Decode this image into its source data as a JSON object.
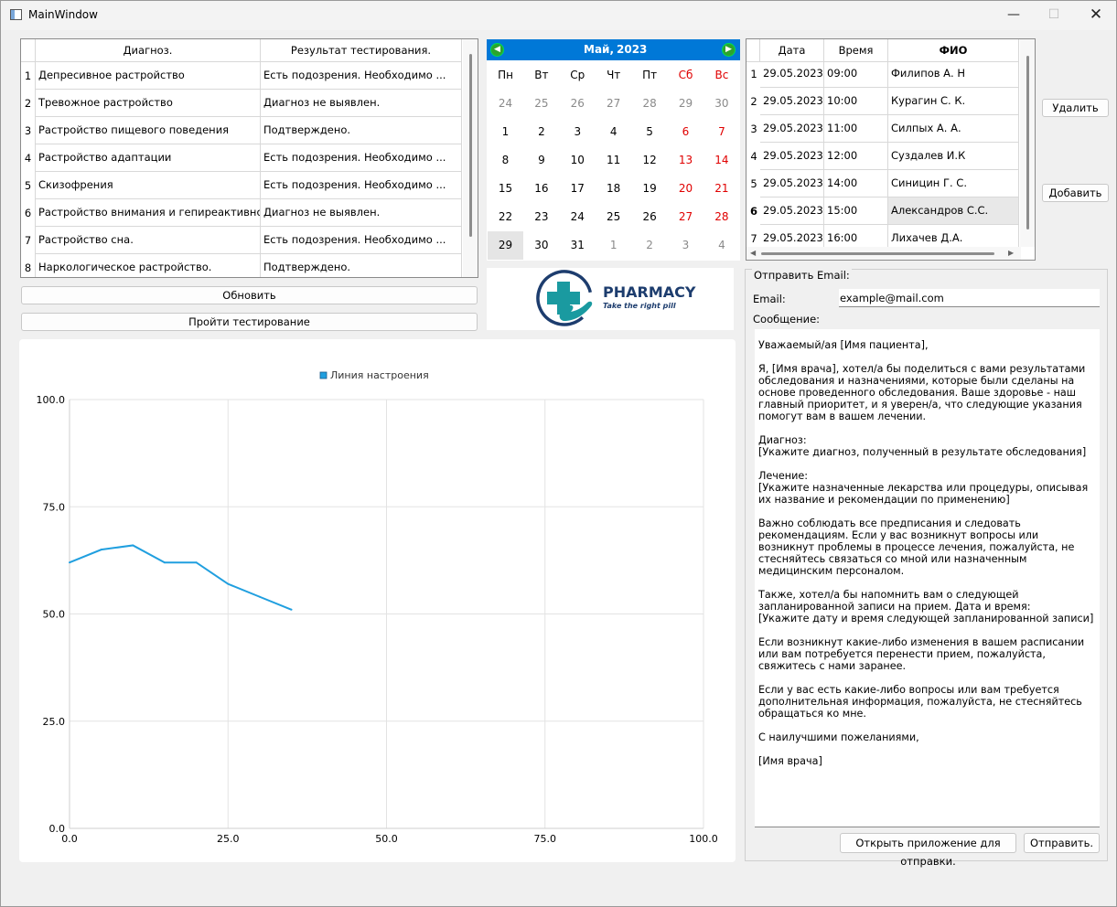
{
  "window": {
    "title": "MainWindow",
    "minimize": "—",
    "maximize": "☐",
    "close": "✕"
  },
  "diagnosis_table": {
    "headers": [
      "Диагноз.",
      "Результат тестирования."
    ],
    "rows": [
      {
        "n": "1",
        "diagnosis": "Депресивное растройство",
        "result": "Есть подозрения. Необходимо ..."
      },
      {
        "n": "2",
        "diagnosis": "Тревожное растройство",
        "result": "Диагноз не выявлен."
      },
      {
        "n": "3",
        "diagnosis": "Растройство пищевого поведения",
        "result": "Подтверждено."
      },
      {
        "n": "4",
        "diagnosis": "Растройство адаптации",
        "result": "Есть подозрения. Необходимо ..."
      },
      {
        "n": "5",
        "diagnosis": "Скизофрения",
        "result": "Есть подозрения. Необходимо ..."
      },
      {
        "n": "6",
        "diagnosis": "Растройство внимания и гепиреактивности",
        "result": "Диагноз не выявлен."
      },
      {
        "n": "7",
        "diagnosis": "Растройство сна.",
        "result": "Есть подозрения. Необходимо ..."
      },
      {
        "n": "8",
        "diagnosis": "Наркологическое растройство.",
        "result": "Подтверждено."
      }
    ]
  },
  "buttons": {
    "refresh": "Обновить",
    "take_test": "Пройти тестирование",
    "delete": "Удалить",
    "add": "Добавить",
    "open_app": "Открыть приложение для отправки.",
    "send": "Отправить."
  },
  "calendar": {
    "month": "Май,",
    "year": "2023",
    "prev_icon": "arrow-left-icon",
    "next_icon": "arrow-right-icon",
    "weekdays": [
      "Пн",
      "Вт",
      "Ср",
      "Чт",
      "Пт",
      "Сб",
      "Вс"
    ],
    "weeks": [
      [
        "24",
        "25",
        "26",
        "27",
        "28",
        "29",
        "30"
      ],
      [
        "1",
        "2",
        "3",
        "4",
        "5",
        "6",
        "7"
      ],
      [
        "8",
        "9",
        "10",
        "11",
        "12",
        "13",
        "14"
      ],
      [
        "15",
        "16",
        "17",
        "18",
        "19",
        "20",
        "21"
      ],
      [
        "22",
        "23",
        "24",
        "25",
        "26",
        "27",
        "28"
      ],
      [
        "29",
        "30",
        "31",
        "1",
        "2",
        "3",
        "4"
      ]
    ],
    "selected_day": "29",
    "colors": {
      "header": "#0078d7",
      "weekend": "#e00000",
      "other_month": "#8a8a8a",
      "selected_bg": "#e5e5e5"
    }
  },
  "logo": {
    "title": "PHARMACY",
    "tagline": "Take the right pill",
    "colors": {
      "teal": "#1a9aa0",
      "navy": "#1d3d6e"
    }
  },
  "appointments": {
    "headers": [
      "Дата",
      "Время",
      "ФИО"
    ],
    "rows": [
      {
        "n": "1",
        "date": "29.05.2023",
        "time": "09:00",
        "name": "Филипов А. Н"
      },
      {
        "n": "2",
        "date": "29.05.2023",
        "time": "10:00",
        "name": "Курагин С. К."
      },
      {
        "n": "3",
        "date": "29.05.2023",
        "time": "11:00",
        "name": "Силпых А. А."
      },
      {
        "n": "4",
        "date": "29.05.2023",
        "time": "12:00",
        "name": "Суздалев И.К"
      },
      {
        "n": "5",
        "date": "29.05.2023",
        "time": "14:00",
        "name": "Синицин Г. С."
      },
      {
        "n": "6",
        "date": "29.05.2023",
        "time": "15:00",
        "name": "Александров С.С."
      },
      {
        "n": "7",
        "date": "29.05.2023",
        "time": "16:00",
        "name": "Лихачев Д.А."
      }
    ],
    "selected_row": 5
  },
  "chart_data": {
    "type": "line",
    "legend": "Линия настроения",
    "legend_position": "top-center",
    "series": [
      {
        "name": "Линия настроения",
        "color": "#209fdf",
        "x": [
          0,
          5,
          10,
          15,
          20,
          25,
          30,
          35
        ],
        "y": [
          62,
          65,
          66,
          62,
          62,
          57,
          54,
          51
        ]
      }
    ],
    "xlim": [
      0,
      100
    ],
    "ylim": [
      0,
      100
    ],
    "x_ticks": [
      "0.0",
      "25.0",
      "50.0",
      "75.0",
      "100.0"
    ],
    "y_ticks": [
      "0.0",
      "25.0",
      "50.0",
      "75.0",
      "100.0"
    ],
    "grid": true
  },
  "email": {
    "group_title": "Отправить Email:",
    "email_label": "Email:",
    "email_value": "example@mail.com",
    "message_label": "Сообщение:",
    "message": "Уважаемый/ая [Имя пациента],\n\nЯ, [Имя врача], хотел/а бы поделиться с вами результатами обследования и назначениями, которые были сделаны на основе проведенного обследования. Ваше здоровье - наш главный приоритет, и я уверен/а, что следующие указания помогут вам в вашем лечении.\n\nДиагноз:\n[Укажите диагноз, полученный в результате обследования]\n\nЛечение:\n[Укажите назначенные лекарства или процедуры, описывая их название и рекомендации по применению]\n\nВажно соблюдать все предписания и следовать рекомендациям. Если у вас возникнут вопросы или возникнут проблемы в процессе лечения, пожалуйста, не стесняйтесь связаться со мной или назначенным медицинским персоналом.\n\nТакже, хотел/а бы напомнить вам о следующей запланированной записи на прием. Дата и время:\n[Укажите дату и время следующей запланированной записи]\n\nЕсли возникнут какие-либо изменения в вашем расписании или вам потребуется перенести прием, пожалуйста, свяжитесь с нами заранее.\n\nЕсли у вас есть какие-либо вопросы или вам требуется дополнительная информация, пожалуйста, не стесняйтесь обращаться ко мне.\n\nС наилучшими пожеланиями,\n\n[Имя врача]"
  }
}
